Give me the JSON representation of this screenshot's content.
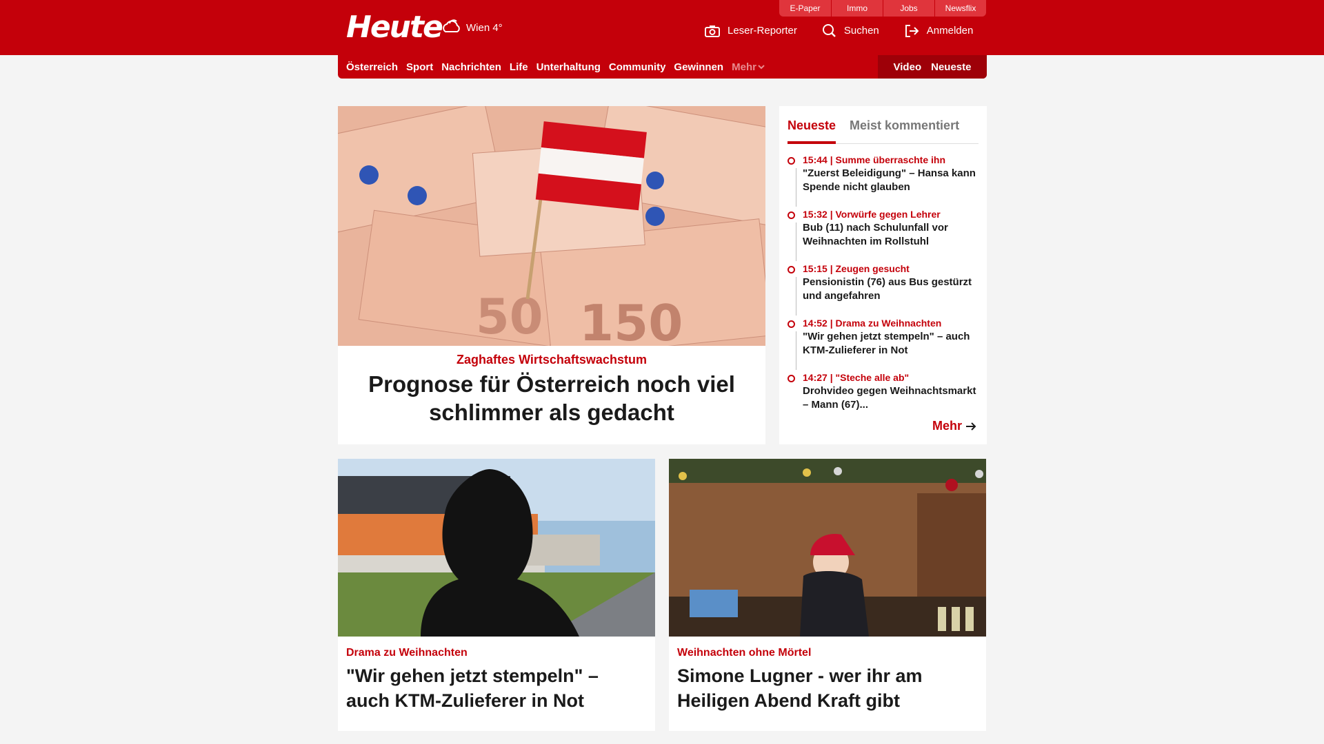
{
  "header": {
    "logo": "Heute",
    "weather": "Wien 4°",
    "top_buttons": [
      "E-Paper",
      "Immo",
      "Jobs",
      "Newsflix"
    ],
    "actions": [
      {
        "label": "Leser-Reporter",
        "icon": "camera-icon"
      },
      {
        "label": "Suchen",
        "icon": "search-icon"
      },
      {
        "label": "Anmelden",
        "icon": "login-icon"
      }
    ]
  },
  "nav": {
    "items": [
      "Österreich",
      "Sport",
      "Nachrichten",
      "Life",
      "Unterhaltung",
      "Community",
      "Gewinnen"
    ],
    "more": "Mehr",
    "right": [
      "Video",
      "Neueste"
    ]
  },
  "hero": {
    "kicker": "Zaghaftes Wirtschaftswachstum",
    "title": "Prognose für Österreich noch viel schlimmer als gedacht"
  },
  "sidebar": {
    "tabs": [
      "Neueste",
      "Meist kommentiert"
    ],
    "items": [
      {
        "time": "15:44 | Summe überraschte ihn",
        "title": "\"Zuerst Beleidigung\" – Hansa kann Spende nicht glauben"
      },
      {
        "time": "15:32 | Vorwürfe gegen Lehrer",
        "title": "Bub (11) nach Schulunfall vor Weihnachten im Rollstuhl"
      },
      {
        "time": "15:15 | Zeugen gesucht",
        "title": "Pensionistin (76) aus Bus gestürzt und angefahren"
      },
      {
        "time": "14:52 | Drama zu Weihnachten",
        "title": "\"Wir gehen jetzt stempeln\" – auch KTM-Zulieferer in Not"
      },
      {
        "time": "14:27 | \"Steche alle ab\"",
        "title": "Drohvideo gegen Weihnachtsmarkt – Mann (67)..."
      }
    ],
    "more": "Mehr"
  },
  "cards": [
    {
      "kicker": "Drama zu Weihnachten",
      "title": "\"Wir gehen jetzt stempeln\" – auch KTM-Zulieferer in Not"
    },
    {
      "kicker": "Weihnachten ohne Mörtel",
      "title": "Simone Lugner - wer ihr am Heiligen Abend Kraft gibt"
    }
  ],
  "colors": {
    "brand": "#c4000a",
    "background": "#f4f4f4"
  }
}
